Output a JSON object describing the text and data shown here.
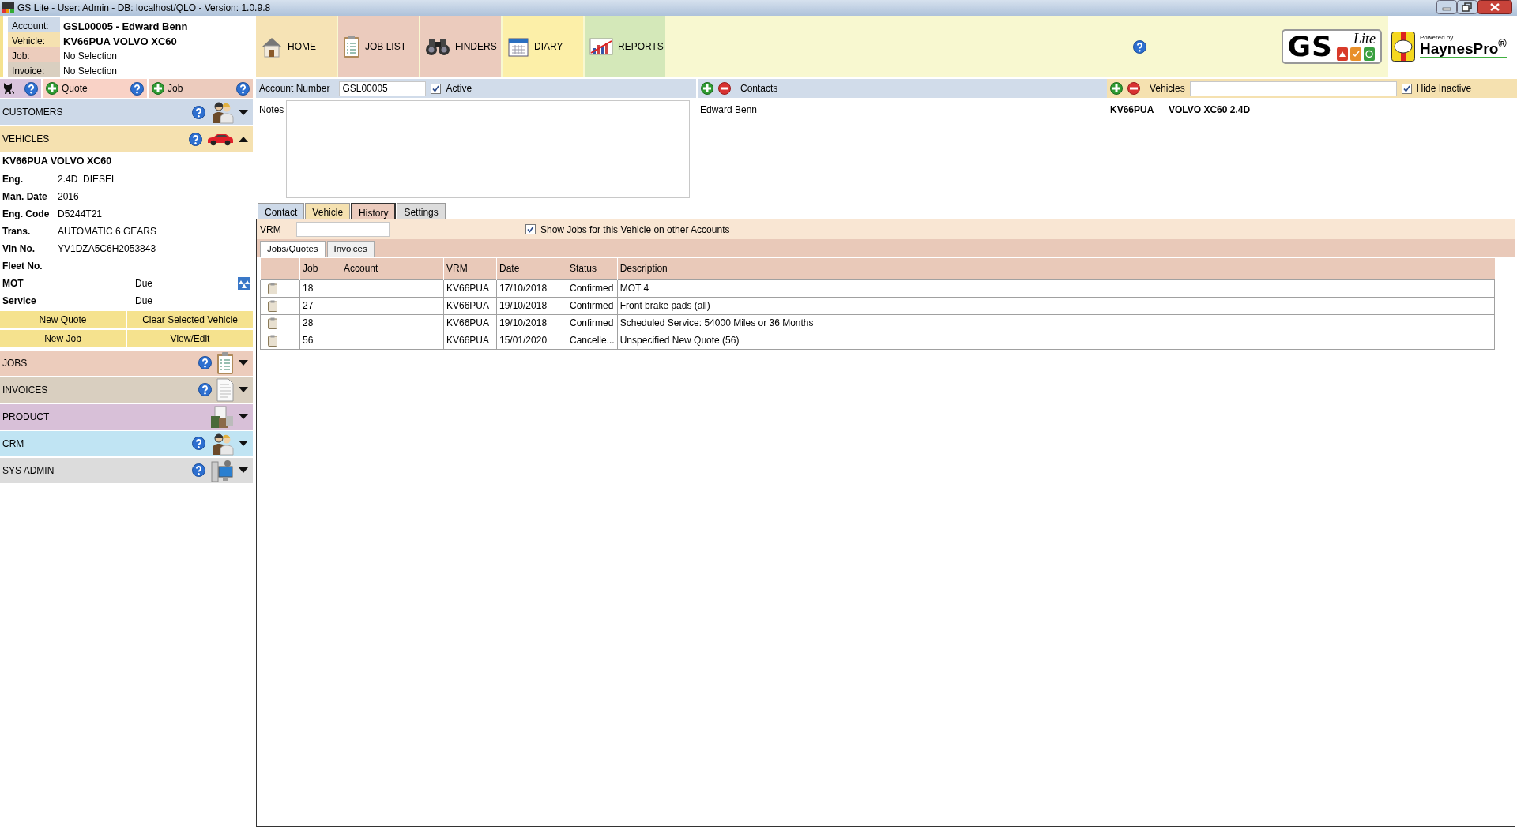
{
  "window": {
    "title": "GS Lite - User: Admin - DB: localhost/QLO - Version: 1.0.9.8"
  },
  "summary": [
    {
      "label": "Account:",
      "value": "GSL00005 - Edward Benn",
      "selected": true,
      "color": "#cdd9e8"
    },
    {
      "label": "Vehicle:",
      "value": "KV66PUA VOLVO XC60",
      "selected": true,
      "color": "#f5e1b0"
    },
    {
      "label": "Job:",
      "value": "No Selection",
      "selected": false,
      "color": "#ecccbc"
    },
    {
      "label": "Invoice:",
      "value": "No Selection",
      "selected": false,
      "color": "#d9cfc0"
    }
  ],
  "toolbar": [
    {
      "kind": "cat",
      "color": "#d9c3dc"
    },
    {
      "kind": "add",
      "label": "Quote",
      "color": "#f9d2c6"
    },
    {
      "kind": "add",
      "label": "Job",
      "color": "#eccbbd"
    }
  ],
  "sections": [
    {
      "label": "CUSTOMERS",
      "kind": "people",
      "help": true,
      "expanded": false,
      "color": "#cdd9e8"
    },
    {
      "label": "VEHICLES",
      "kind": "car",
      "help": true,
      "expanded": true,
      "color": "#f5e1b0",
      "details": {
        "title": "KV66PUA VOLVO XC60",
        "fields": [
          {
            "label": "Eng.",
            "value": "2.4D  DIESEL"
          },
          {
            "label": "Man. Date",
            "value": "2016"
          },
          {
            "label": "Eng. Code",
            "value": "D5244T21"
          },
          {
            "label": "Trans.",
            "value": "AUTOMATIC 6 GEARS"
          },
          {
            "label": "Vin No.",
            "value": "YV1DZA5C6H2053843"
          },
          {
            "label": "Fleet No."
          }
        ],
        "due": [
          {
            "label": "MOT",
            "value": "Due",
            "kind": "mot"
          },
          {
            "label": "Service",
            "value": "Due",
            "kind": "service"
          }
        ],
        "buttons": [
          "New Quote",
          "Clear Selected Vehicle",
          "New Job",
          "View/Edit"
        ]
      }
    },
    {
      "label": "JOBS",
      "kind": "clipboard",
      "help": true,
      "expanded": false,
      "color": "#ecccbc"
    },
    {
      "label": "INVOICES",
      "kind": "document",
      "help": true,
      "expanded": false,
      "color": "#d9cfc0"
    },
    {
      "label": "PRODUCT",
      "kind": "boxes",
      "help": false,
      "expanded": false,
      "color": "#d8c0d8"
    },
    {
      "label": "CRM",
      "kind": "people",
      "help": true,
      "expanded": false,
      "color": "#c0e4f3"
    },
    {
      "label": "SYS ADMIN",
      "kind": "computer",
      "help": true,
      "expanded": false,
      "color": "#dcdcdc"
    }
  ],
  "nav": [
    {
      "label": "HOME",
      "kind": "home",
      "color": "#f6e3b5"
    },
    {
      "label": "JOB LIST",
      "kind": "clipboard",
      "color": "#ebcbbd"
    },
    {
      "label": "FINDERS",
      "kind": "binoculars",
      "color": "#ebcbbd"
    },
    {
      "label": "DIARY",
      "kind": "calendar",
      "color": "#fcefa8"
    },
    {
      "label": "REPORTS",
      "kind": "chart",
      "color": "#d4e8b9"
    }
  ],
  "logos": {
    "gs": {
      "text": "GS",
      "sub": "Lite"
    },
    "haynes": {
      "powered": "Powered by",
      "name": "HaynesPro$^{®}$"
    }
  },
  "account": {
    "label": "Account Number",
    "value": "GSL00005",
    "active_label": "Active",
    "active": true,
    "notes_label": "Notes"
  },
  "contacts": {
    "label": "Contacts",
    "items": [
      "Edward Benn"
    ]
  },
  "vehicles": {
    "label": "Vehicles",
    "hide_inactive_label": "Hide Inactive",
    "hide_inactive": true,
    "items": [
      {
        "reg": "KV66PUA",
        "description": "VOLVO XC60 2.4D"
      }
    ]
  },
  "tabs": [
    {
      "label": "Contact",
      "selected": false,
      "color": "#cdd9e8"
    },
    {
      "label": "Vehicle",
      "selected": false,
      "color": "#f5e1b0"
    },
    {
      "label": "History",
      "selected": true,
      "color": "#ebcbbd"
    },
    {
      "label": "Settings",
      "selected": false,
      "color": "#dcdcdc"
    }
  ],
  "history": {
    "vrm_label": "VRM",
    "show_other_label": "Show Jobs for this Vehicle on other Accounts",
    "show_other": true,
    "subtabs": [
      {
        "label": "Jobs/Quotes",
        "selected": true
      },
      {
        "label": "Invoices",
        "selected": false
      }
    ],
    "table": {
      "columns": [
        "Job",
        "Account",
        "VRM",
        "Date",
        "Status",
        "Description"
      ],
      "rows": [
        {
          "job": "18",
          "vrm": "KV66PUA",
          "date": "17/10/2018",
          "status": "Confirmed",
          "description": "MOT 4"
        },
        {
          "job": "27",
          "vrm": "KV66PUA",
          "date": "19/10/2018",
          "status": "Confirmed",
          "description": "Front brake pads (all)"
        },
        {
          "job": "28",
          "vrm": "KV66PUA",
          "date": "19/10/2018",
          "status": "Confirmed",
          "description": "Scheduled Service: 54000 Miles or 36 Months"
        },
        {
          "job": "56",
          "vrm": "KV66PUA",
          "date": "15/01/2020",
          "status": "Cancelle...",
          "description": "Unspecified New  Quote (56)"
        }
      ]
    }
  }
}
